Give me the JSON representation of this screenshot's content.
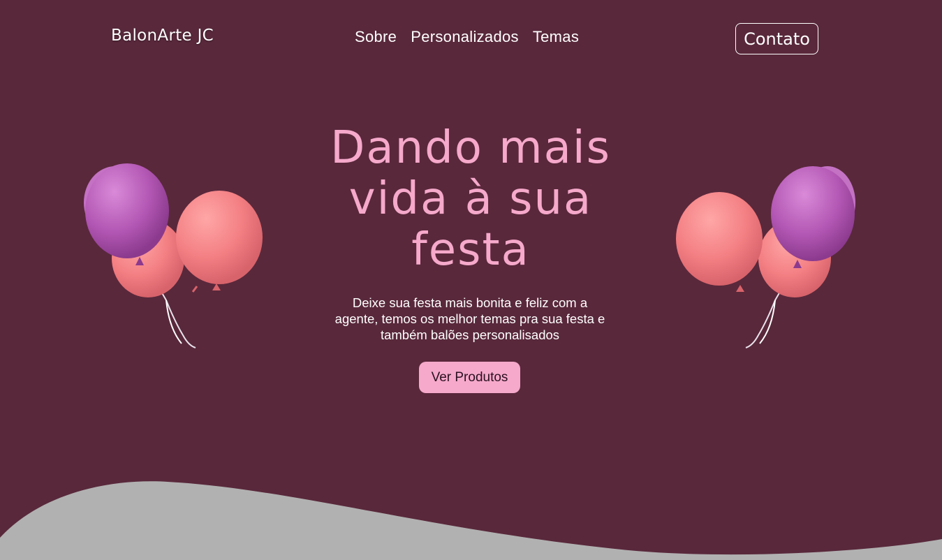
{
  "brand": {
    "name": "BalonArte JC"
  },
  "nav": {
    "items": [
      {
        "label": "Sobre"
      },
      {
        "label": "Personalizados"
      },
      {
        "label": "Temas"
      }
    ]
  },
  "header": {
    "contact_label": "Contato"
  },
  "hero": {
    "title": "Dando mais vida à sua festa",
    "subtitle": "Deixe sua festa mais bonita e feliz com a agente, temos os melhor temas pra sua festa e também balões personalisados",
    "cta_label": "Ver Produtos"
  },
  "colors": {
    "background": "#59283b",
    "accent_pink": "#f6a9cb",
    "balloon_purple": "#b357b4",
    "balloon_coral": "#f37f83",
    "wave_gray": "#b1b1b1"
  },
  "icons": {
    "decor": "balloon-cluster-icon"
  }
}
